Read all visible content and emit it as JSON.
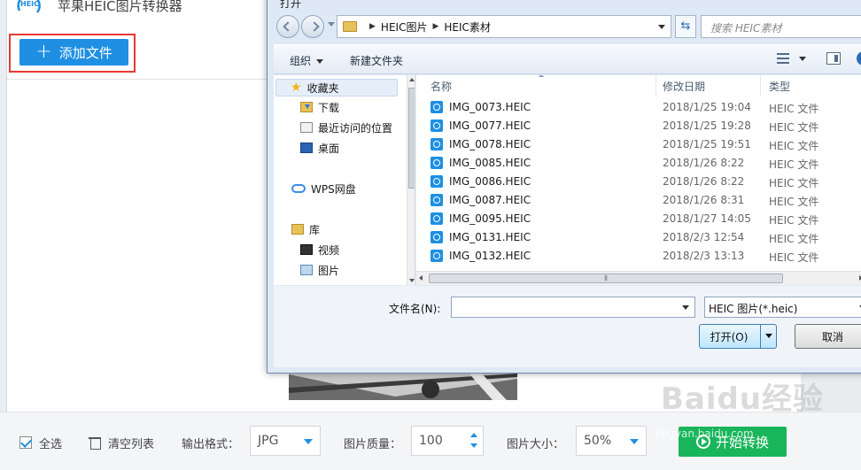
{
  "app": {
    "title": "苹果HEIC图片转换器",
    "logo_text": "HEIC",
    "add_file_label": "添加文件",
    "accent_color": "#1e8fe3",
    "highlight_color": "#e53935",
    "bottom": {
      "select_all_label": "全选",
      "clear_list_label": "清空列表",
      "output_format_label": "输出格式：",
      "output_format_value": "JPG",
      "quality_label": "图片质量：",
      "quality_value": "100",
      "size_label": "图片大小：",
      "size_value": "50%",
      "start_label": "开始转换",
      "start_color": "#19b55b"
    }
  },
  "dialog": {
    "title": "打开",
    "breadcrumbs": [
      "HEIC图片",
      "HEIC素材"
    ],
    "search_placeholder": "搜索 HEIC素材",
    "toolbar": {
      "organize": "组织",
      "new_folder": "新建文件夹"
    },
    "nav": {
      "favorites": "收藏夹",
      "downloads": "下载",
      "recent": "最近访问的位置",
      "desktop": "桌面",
      "wps": "WPS网盘",
      "library": "库",
      "videos": "视频",
      "pictures": "图片"
    },
    "columns": {
      "name": "名称",
      "modified": "修改日期",
      "type": "类型"
    },
    "files": [
      {
        "name": "IMG_0073.HEIC",
        "date": "2018/1/25 19:04",
        "type": "HEIC 文件"
      },
      {
        "name": "IMG_0077.HEIC",
        "date": "2018/1/25 19:28",
        "type": "HEIC 文件"
      },
      {
        "name": "IMG_0078.HEIC",
        "date": "2018/1/25 19:51",
        "type": "HEIC 文件"
      },
      {
        "name": "IMG_0085.HEIC",
        "date": "2018/1/26 8:22",
        "type": "HEIC 文件"
      },
      {
        "name": "IMG_0086.HEIC",
        "date": "2018/1/26 8:22",
        "type": "HEIC 文件"
      },
      {
        "name": "IMG_0087.HEIC",
        "date": "2018/1/26 8:31",
        "type": "HEIC 文件"
      },
      {
        "name": "IMG_0095.HEIC",
        "date": "2018/1/27 14:05",
        "type": "HEIC 文件"
      },
      {
        "name": "IMG_0131.HEIC",
        "date": "2018/2/3 12:54",
        "type": "HEIC 文件"
      },
      {
        "name": "IMG_0132.HEIC",
        "date": "2018/2/3 13:13",
        "type": "HEIC 文件"
      }
    ],
    "filename_label": "文件名(N):",
    "filename_value": "",
    "filetype_value": "HEIC 图片(*.heic)",
    "open_label": "打开(O)",
    "cancel_label": "取消"
  },
  "watermark": {
    "text": "Baidu经验",
    "sub": "jingyan.baidu.com"
  }
}
